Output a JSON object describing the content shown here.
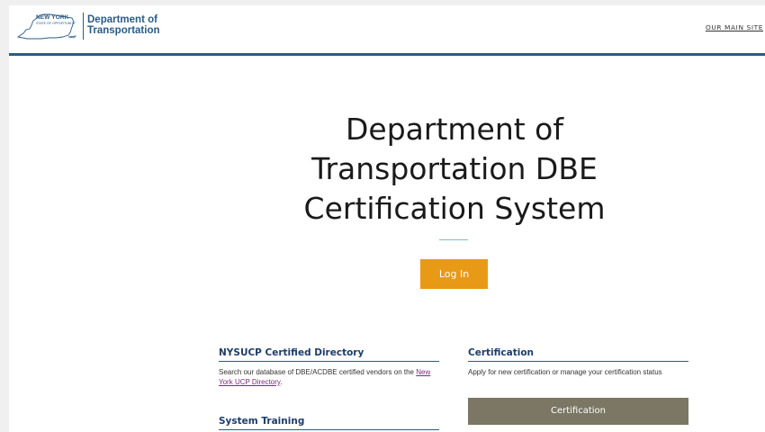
{
  "header": {
    "logo": {
      "state": "NEW YORK",
      "state_sub": "STATE OF OPPORTUNITY",
      "dept_line1": "Department of",
      "dept_line2": "Transportation"
    },
    "main_site_link": "OUR MAIN SITE"
  },
  "hero": {
    "title_line1": "Department of",
    "title_line2": "Transportation DBE",
    "title_line3": "Certification System",
    "login_label": "Log In"
  },
  "sections": {
    "directory": {
      "title": "NYSUCP Certified Directory",
      "text": "Search our database of DBE/ACDBE certified vendors on the ",
      "link": "New York UCP Directory",
      "text_end": "."
    },
    "certification": {
      "title": "Certification",
      "text": "Apply for new certification or manage your certification status",
      "button_label": "Certification"
    },
    "training": {
      "title": "System Training"
    }
  },
  "colors": {
    "brand_blue": "#2a5b87",
    "login_orange": "#e89a16",
    "cert_button": "#7b7764",
    "link_purple": "#7c2c7a"
  }
}
